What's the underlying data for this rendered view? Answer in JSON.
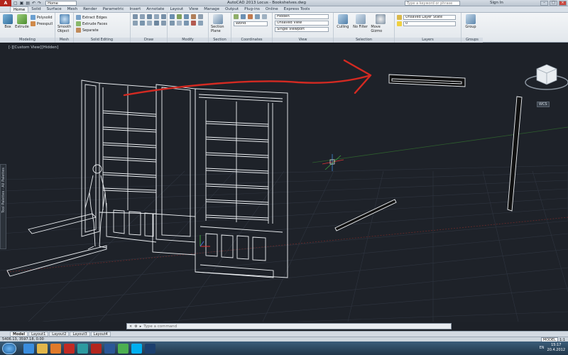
{
  "titlebar": {
    "app_button": "A",
    "workspace": "Home",
    "window_title": "AutoCAD 2013   Locus - Bookshelves.dwg",
    "search_placeholder": "Type a keyword or phrase",
    "signin": "Sign In"
  },
  "tabs": [
    "Home",
    "Solid",
    "Surface",
    "Mesh",
    "Render",
    "Parametric",
    "Insert",
    "Annotate",
    "Layout",
    "View",
    "Manage",
    "Output",
    "Plug-ins",
    "Online",
    "Express Tools"
  ],
  "ribbon": {
    "modeling": {
      "title": "Modeling",
      "box": "Box",
      "extrude": "Extrude",
      "polysolid": "Polysolid",
      "presspull": "Presspull"
    },
    "mesh": {
      "title": "Mesh",
      "smooth": "Smooth Object"
    },
    "solid_editing": {
      "title": "Solid Editing",
      "extract": "Extract Edges",
      "extrude_faces": "Extrude Faces",
      "separate": "Separate"
    },
    "draw": {
      "title": "Draw"
    },
    "modify": {
      "title": "Modify"
    },
    "section": {
      "title": "Section",
      "plane": "Section Plane"
    },
    "coordinates": {
      "title": "Coordinates",
      "world": "World"
    },
    "view": {
      "title": "View",
      "visual_style": "Hidden",
      "named_view": "Unsaved View",
      "viewport": "Single Viewport"
    },
    "selection": {
      "title": "Selection",
      "culling": "Culling",
      "no_filter": "No Filter",
      "gizmo": "Move Gizmo"
    },
    "layers": {
      "title": "Layers",
      "state": "Unsaved Layer State",
      "current": "0"
    },
    "groups": {
      "title": "Groups",
      "group": "Group"
    }
  },
  "viewport": {
    "label": "[-][Custom View][Hidden]",
    "wcs": "WCS",
    "palette": "Tool Palettes - All Palettes"
  },
  "command": {
    "placeholder": "Type a command"
  },
  "layout_tabs": [
    "Model",
    "Layout1",
    "Layout2",
    "Layout3",
    "Layout4"
  ],
  "status": {
    "coords": "5406.13, 3597.18, 0.00",
    "model": "MODEL",
    "scale": "1:1"
  },
  "taskbar": {
    "lang": "EN",
    "time": "15:17",
    "date": "20.4.2012"
  },
  "colors": {
    "accent_red": "#d42a22",
    "bg": "#1e2229",
    "line": "#e9edf1"
  }
}
